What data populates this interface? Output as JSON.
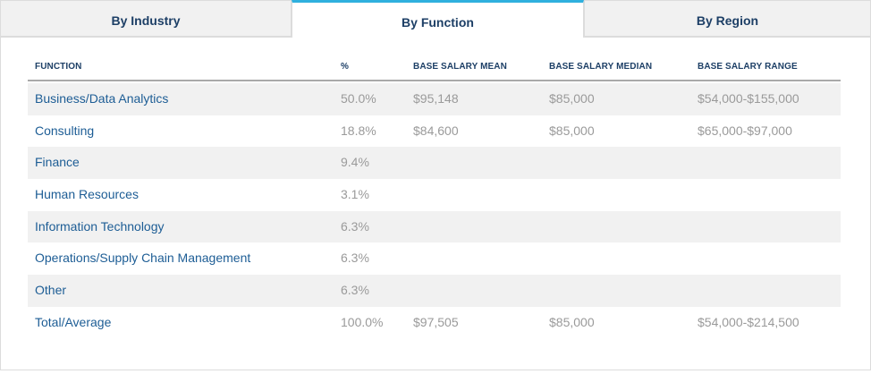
{
  "tabs": [
    {
      "label": "By Industry",
      "active": false
    },
    {
      "label": "By Function",
      "active": true
    },
    {
      "label": "By Region",
      "active": false
    }
  ],
  "colors": {
    "accent": "#2fb0de",
    "header_text": "#1d3f66",
    "link_text": "#1d5d95",
    "muted_text": "#9a9a9a",
    "stripe": "#f1f1f1"
  },
  "table": {
    "columns": [
      "FUNCTION",
      "%",
      "BASE SALARY MEAN",
      "BASE SALARY MEDIAN",
      "BASE SALARY RANGE"
    ],
    "rows": [
      {
        "function": "Business/Data Analytics",
        "pct": "50.0%",
        "mean": "$95,148",
        "median": "$85,000",
        "range": "$54,000-$155,000"
      },
      {
        "function": "Consulting",
        "pct": "18.8%",
        "mean": "$84,600",
        "median": "$85,000",
        "range": "$65,000-$97,000"
      },
      {
        "function": "Finance",
        "pct": "9.4%",
        "mean": "",
        "median": "",
        "range": ""
      },
      {
        "function": "Human Resources",
        "pct": "3.1%",
        "mean": "",
        "median": "",
        "range": ""
      },
      {
        "function": "Information Technology",
        "pct": "6.3%",
        "mean": "",
        "median": "",
        "range": ""
      },
      {
        "function": "Operations/Supply Chain Management",
        "pct": "6.3%",
        "mean": "",
        "median": "",
        "range": ""
      },
      {
        "function": "Other",
        "pct": "6.3%",
        "mean": "",
        "median": "",
        "range": ""
      },
      {
        "function": "Total/Average",
        "pct": "100.0%",
        "mean": "$97,505",
        "median": "$85,000",
        "range": "$54,000-$214,500"
      }
    ]
  }
}
